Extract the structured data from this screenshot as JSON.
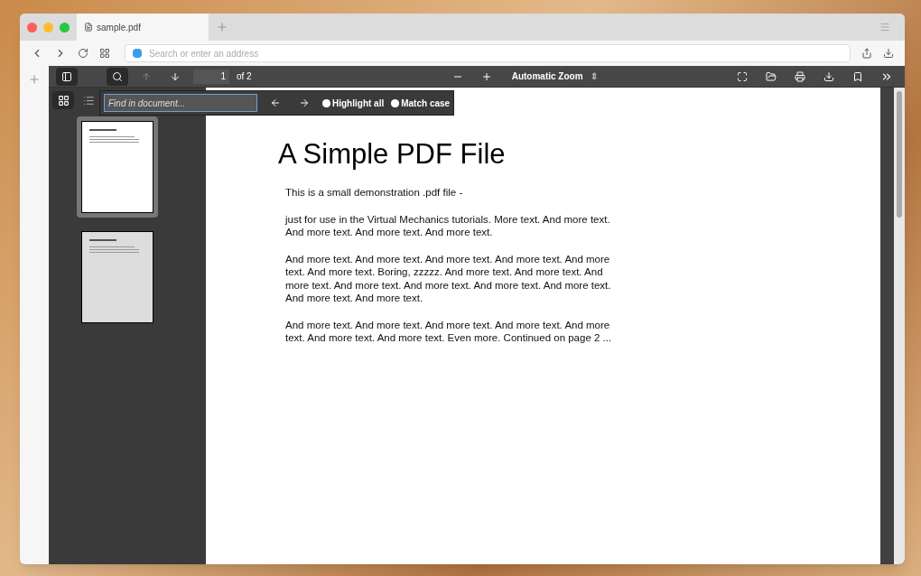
{
  "tab": {
    "title": "sample.pdf"
  },
  "address_bar": {
    "placeholder": "Search or enter an address"
  },
  "toolbar": {
    "sidebar_open": true,
    "find_open": true,
    "page_number": "1",
    "page_count": "of 2",
    "zoom": "Automatic Zoom",
    "zoom_arrow": "⇕"
  },
  "sidebar": {
    "views": [
      {
        "kind": "thumbnails",
        "selected": true
      },
      {
        "kind": "outline",
        "selected": false
      }
    ],
    "thumbnails": [
      {
        "selected": true
      },
      {
        "selected": false
      }
    ]
  },
  "find_bar": {
    "placeholder": "Find in document...",
    "options": [
      {
        "label": "Highlight all",
        "checked": false
      },
      {
        "label": "Match case",
        "checked": false
      }
    ]
  },
  "document": {
    "title": "A Simple PDF File",
    "paragraphs": [
      "This is a small demonstration .pdf file -",
      "just for use in the Virtual Mechanics tutorials. More text. And more text. And more text. And more text. And more text.",
      "And more text. And more text. And more text. And more text. And more text. And more text. Boring, zzzzz. And more text. And more text. And more text. And more text. And more text. And more text. And more text. And more text. And more text.",
      "And more text. And more text. And more text. And more text. And more text. And more text. And more text. Even more. Continued on page 2 ..."
    ]
  }
}
